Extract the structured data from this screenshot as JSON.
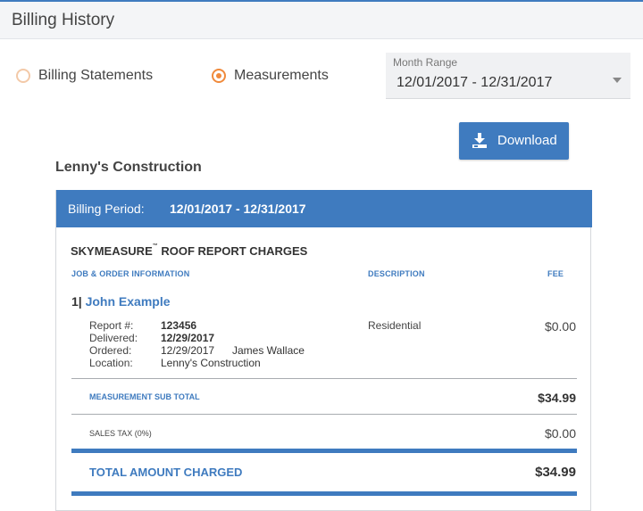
{
  "header": {
    "title": "Billing History"
  },
  "view_toggle": {
    "options": [
      {
        "label": "Billing Statements",
        "selected": false
      },
      {
        "label": "Measurements",
        "selected": true
      }
    ]
  },
  "month_range": {
    "label": "Month Range",
    "value": "12/01/2017 - 12/31/2017"
  },
  "download": {
    "label": "Download",
    "icon": "download-icon"
  },
  "company": "Lenny's Construction",
  "billing": {
    "period_label": "Billing Period:",
    "period_value": "12/01/2017 - 12/31/2017",
    "section_title": "SKYMEASURE",
    "section_tm": "™",
    "section_title_rest": " ROOF REPORT CHARGES",
    "columns": {
      "job": "JOB & ORDER INFORMATION",
      "description": "DESCRIPTION",
      "fee": "FEE"
    },
    "order": {
      "number": "1|",
      "name": "John Example",
      "report_label": "Report #:",
      "report_value": "123456",
      "delivered_label": "Delivered:",
      "delivered_value": "12/29/2017",
      "ordered_label": "Ordered:",
      "ordered_value": "12/29/2017",
      "ordered_by": "James Wallace",
      "location_label": "Location:",
      "location_value": "Lenny's Construction",
      "description": "Residential",
      "fee": "$0.00"
    },
    "subtotal_label": "MEASUREMENT SUB TOTAL",
    "subtotal_value": "$34.99",
    "tax_label": "SALES TAX (0%)",
    "tax_value": "$0.00",
    "total_label": "TOTAL AMOUNT CHARGED",
    "total_value": "$34.99"
  },
  "colors": {
    "accent": "#3f7bbf",
    "radio": "#f08a3c"
  }
}
